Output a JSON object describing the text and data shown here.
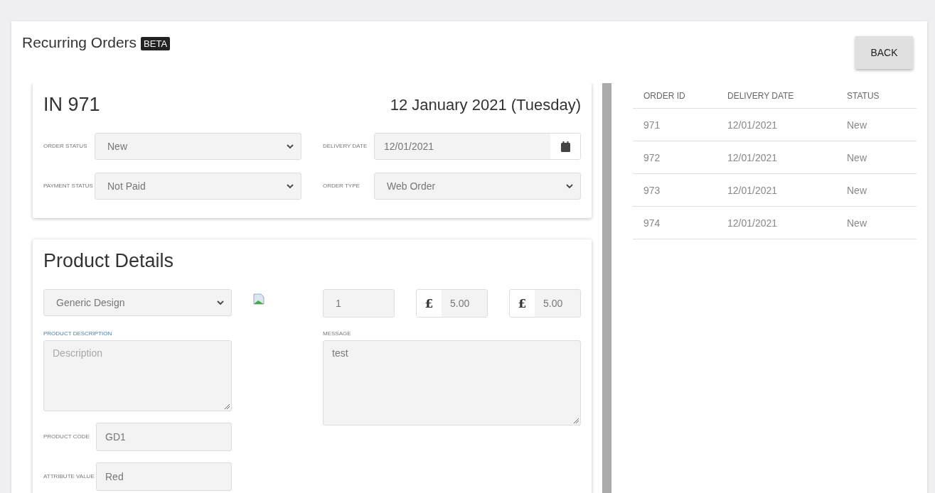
{
  "header": {
    "title": "Recurring Orders",
    "badge": "BETA",
    "back_button": "BACK"
  },
  "order": {
    "number": "IN 971",
    "date_heading": "12 January 2021 (Tuesday)",
    "fields": [
      {
        "kind": "select",
        "label": "ORDER STATUS",
        "value": "New"
      },
      {
        "kind": "date",
        "label": "DELIVERY DATE",
        "value": "12/01/2021"
      },
      {
        "kind": "select",
        "label": "PAYMENT STATUS",
        "value": "Not Paid"
      },
      {
        "kind": "select",
        "label": "ORDER TYPE",
        "value": "Web Order"
      }
    ]
  },
  "product": {
    "title": "Product Details",
    "design": "Generic Design",
    "quantity": "1",
    "prices": [
      {
        "currency": "£",
        "value": "5.00"
      },
      {
        "currency": "£",
        "value": "5.00"
      }
    ],
    "description": {
      "label": "PRODUCT DESCRIPTION",
      "placeholder": "Description"
    },
    "message": {
      "label": "MESSAGE",
      "value": "test"
    },
    "attributes": [
      {
        "label": "PRODUCT CODE",
        "value": "GD1"
      },
      {
        "label": "ATTRIBUTE VALUE",
        "value": "Red"
      }
    ]
  },
  "orders_table": {
    "columns": [
      "ORDER ID",
      "DELIVERY DATE",
      "STATUS"
    ],
    "rows": [
      [
        "971",
        "12/01/2021",
        "New"
      ],
      [
        "972",
        "12/01/2021",
        "New"
      ],
      [
        "973",
        "12/01/2021",
        "New"
      ],
      [
        "974",
        "12/01/2021",
        "New"
      ]
    ]
  }
}
